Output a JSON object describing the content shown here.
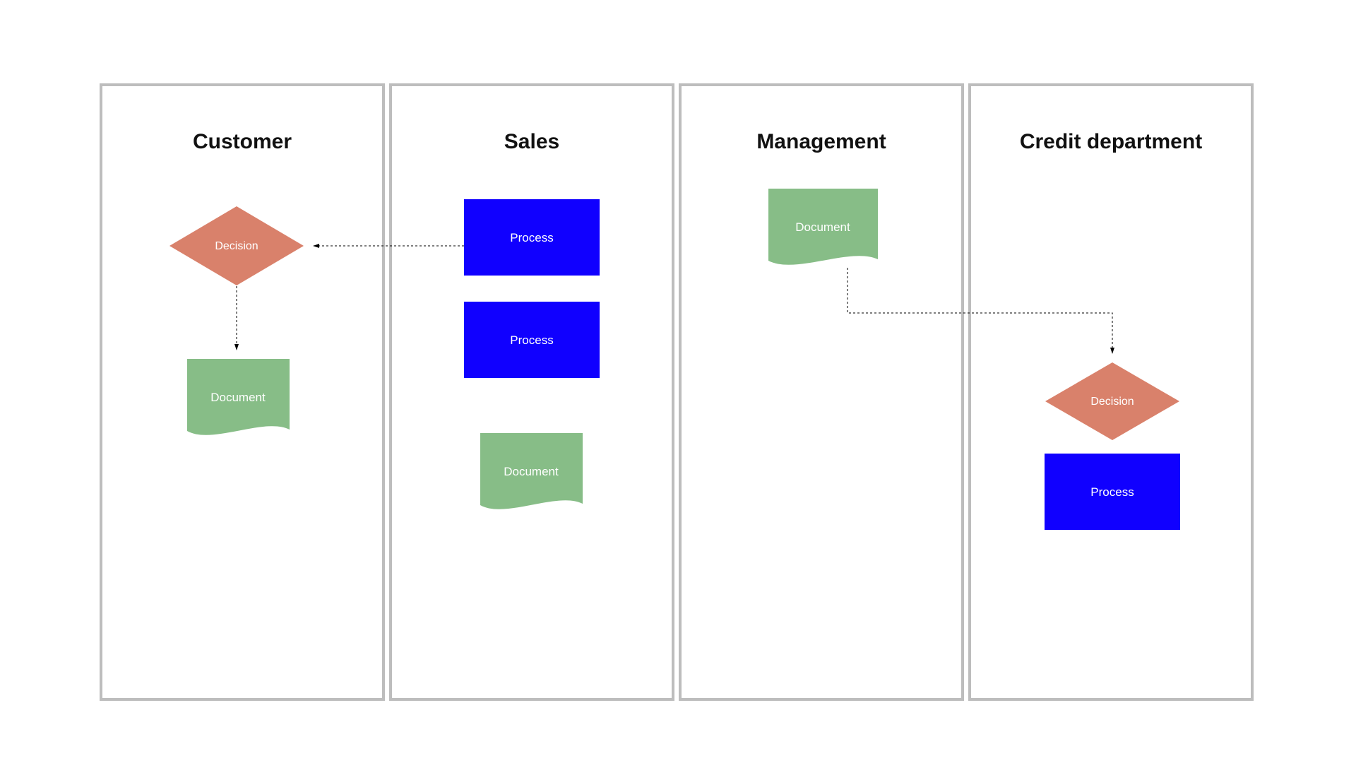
{
  "lanes": {
    "customer": "Customer",
    "sales": "Sales",
    "management": "Management",
    "credit": "Credit department"
  },
  "nodes": {
    "customer_decision": "Decision",
    "customer_document": "Document",
    "sales_process_1": "Process",
    "sales_process_2": "Process",
    "sales_document": "Document",
    "management_document": "Document",
    "credit_decision": "Decision",
    "credit_process": "Process"
  },
  "colors": {
    "lane_border": "#bdbdbd",
    "process": "#1000ff",
    "document": "#87bd87",
    "decision": "#d9816b",
    "connector": "#000000"
  }
}
